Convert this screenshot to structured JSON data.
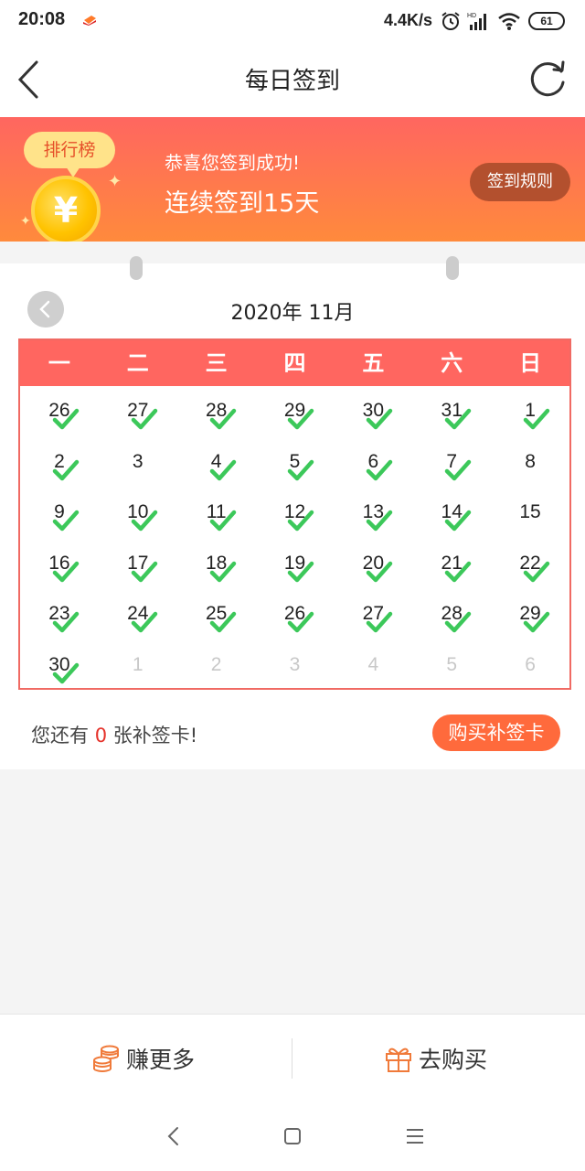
{
  "status_bar": {
    "time": "20:08",
    "net_speed": "4.4K/s",
    "battery": "61"
  },
  "navbar": {
    "title": "每日签到"
  },
  "banner": {
    "rank_label": "排行榜",
    "success_text": "恭喜您签到成功!",
    "streak_text": "连续签到15天",
    "rules_button": "签到规则",
    "coin_symbol": "¥"
  },
  "calendar": {
    "month_title": "2020年 11月",
    "weekdays": [
      "一",
      "二",
      "三",
      "四",
      "五",
      "六",
      "日"
    ],
    "days": [
      {
        "d": "26",
        "other": false,
        "checked": true
      },
      {
        "d": "27",
        "other": false,
        "checked": true
      },
      {
        "d": "28",
        "other": false,
        "checked": true
      },
      {
        "d": "29",
        "other": false,
        "checked": true
      },
      {
        "d": "30",
        "other": false,
        "checked": true
      },
      {
        "d": "31",
        "other": false,
        "checked": true
      },
      {
        "d": "1",
        "other": false,
        "checked": true
      },
      {
        "d": "2",
        "other": false,
        "checked": true
      },
      {
        "d": "3",
        "other": false,
        "checked": false
      },
      {
        "d": "4",
        "other": false,
        "checked": true
      },
      {
        "d": "5",
        "other": false,
        "checked": true
      },
      {
        "d": "6",
        "other": false,
        "checked": true
      },
      {
        "d": "7",
        "other": false,
        "checked": true
      },
      {
        "d": "8",
        "other": false,
        "checked": false
      },
      {
        "d": "9",
        "other": false,
        "checked": true
      },
      {
        "d": "10",
        "other": false,
        "checked": true
      },
      {
        "d": "11",
        "other": false,
        "checked": true
      },
      {
        "d": "12",
        "other": false,
        "checked": true
      },
      {
        "d": "13",
        "other": false,
        "checked": true
      },
      {
        "d": "14",
        "other": false,
        "checked": true
      },
      {
        "d": "15",
        "other": false,
        "checked": false
      },
      {
        "d": "16",
        "other": false,
        "checked": true
      },
      {
        "d": "17",
        "other": false,
        "checked": true
      },
      {
        "d": "18",
        "other": false,
        "checked": true
      },
      {
        "d": "19",
        "other": false,
        "checked": true
      },
      {
        "d": "20",
        "other": false,
        "checked": true
      },
      {
        "d": "21",
        "other": false,
        "checked": true
      },
      {
        "d": "22",
        "other": false,
        "checked": true
      },
      {
        "d": "23",
        "other": false,
        "checked": true
      },
      {
        "d": "24",
        "other": false,
        "checked": true
      },
      {
        "d": "25",
        "other": false,
        "checked": true
      },
      {
        "d": "26",
        "other": false,
        "checked": true
      },
      {
        "d": "27",
        "other": false,
        "checked": true
      },
      {
        "d": "28",
        "other": false,
        "checked": true
      },
      {
        "d": "29",
        "other": false,
        "checked": true
      },
      {
        "d": "30",
        "other": false,
        "checked": true
      },
      {
        "d": "1",
        "other": true,
        "checked": false
      },
      {
        "d": "2",
        "other": true,
        "checked": false
      },
      {
        "d": "3",
        "other": true,
        "checked": false
      },
      {
        "d": "4",
        "other": true,
        "checked": false
      },
      {
        "d": "5",
        "other": true,
        "checked": false
      },
      {
        "d": "6",
        "other": true,
        "checked": false
      }
    ]
  },
  "makeup_card": {
    "prefix": "您还有",
    "count": "0",
    "suffix": "张补签卡!",
    "buy_button": "购买补签卡"
  },
  "bottom_bar": {
    "earn_label": "赚更多",
    "buy_label": "去购买"
  },
  "colors": {
    "accent": "#ff6660",
    "check": "#3cc85a",
    "button_orange": "#ff6a3c"
  }
}
